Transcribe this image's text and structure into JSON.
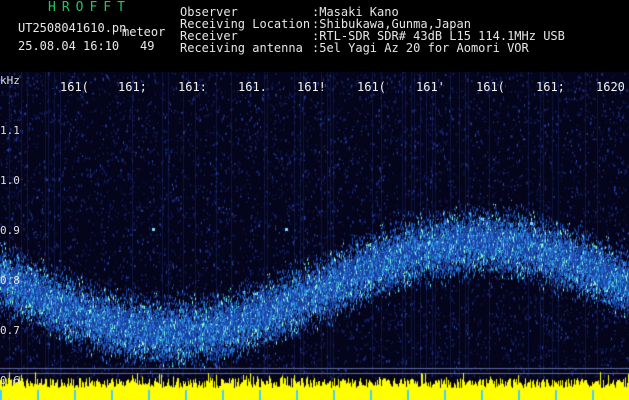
{
  "app": {
    "title": "HROFFT",
    "filename": "UT2508041610.pn",
    "mode": "meteor",
    "date_time": "25.08.04 16:10",
    "count": "49"
  },
  "info": {
    "observer_label": "Observer",
    "observer_value": ":Masaki Kano",
    "location_label": "Receiving Location",
    "location_value": ":Shibukawa,Gunma,Japan",
    "receiver_label": "Receiver",
    "receiver_value": ":RTL-SDR SDR# 43dB L15 114.1MHz USB",
    "antenna_label": "Receiving antenna",
    "antenna_value": ":5el Yagi Az 20 for Aomori VOR"
  },
  "time_ticks": [
    "161(",
    "161;",
    "161:",
    "161.",
    "161!",
    "161(",
    "161'",
    "161(",
    "161;",
    "1620"
  ],
  "freq_axis": {
    "unit": "kHz",
    "labels": [
      "1.1",
      "1.0",
      "0.9",
      "0.8",
      "0.7",
      "0.6"
    ]
  },
  "colors": {
    "background": "#04041a",
    "noise": "#1a2a78",
    "signal_low": "#2a6fd6",
    "signal_high": "#7fffd4",
    "peak": "#ffff33",
    "baseline": "#ffff00"
  }
}
